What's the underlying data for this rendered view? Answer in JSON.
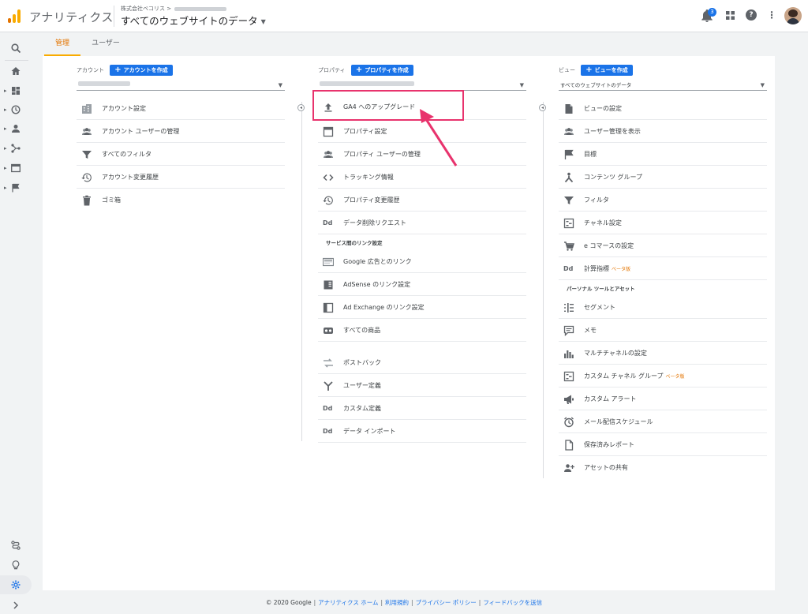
{
  "header": {
    "app_title": "アナリティクス",
    "breadcrumb": "株式会社ベコリス",
    "breadcrumb_sep": ">",
    "view_title": "すべてのウェブサイトのデータ",
    "notification_count": "3",
    "help_label": "?",
    "more_label": "⋮"
  },
  "tabs": [
    {
      "label": "管理"
    },
    {
      "label": "ユーザー"
    }
  ],
  "columns": {
    "account": {
      "label": "アカウント",
      "create_button": "アカウントを作成",
      "items": [
        {
          "label": "アカウント設定",
          "icon": "building-icon"
        },
        {
          "label": "アカウント ユーザーの管理",
          "icon": "people-icon"
        },
        {
          "label": "すべてのフィルタ",
          "icon": "filter-icon"
        },
        {
          "label": "アカウント変更履歴",
          "icon": "history-icon"
        },
        {
          "label": "ゴミ箱",
          "icon": "trash-icon"
        }
      ]
    },
    "property": {
      "label": "プロパティ",
      "create_button": "プロパティを作成",
      "items": [
        {
          "label": "GA4 へのアップグレード",
          "icon": "upload-icon"
        },
        {
          "label": "プロパティ設定",
          "icon": "window-icon"
        },
        {
          "label": "プロパティ ユーザーの管理",
          "icon": "people-icon"
        },
        {
          "label": "トラッキング情報",
          "icon": "code-icon"
        },
        {
          "label": "プロパティ変更履歴",
          "icon": "history-icon"
        },
        {
          "label": "データ削除リクエスト",
          "icon": "dd-icon"
        }
      ],
      "section_label": "サービス間のリンク設定",
      "link_items": [
        {
          "label": "Google 広告とのリンク",
          "icon": "ads-icon"
        },
        {
          "label": "AdSense のリンク設定",
          "icon": "adsense-icon"
        },
        {
          "label": "Ad Exchange のリンク設定",
          "icon": "adexchange-icon"
        },
        {
          "label": "すべての商品",
          "icon": "products-icon"
        }
      ],
      "more_items": [
        {
          "label": "ポストバック",
          "icon": "postback-icon"
        },
        {
          "label": "ユーザー定義",
          "icon": "user-defined-icon"
        },
        {
          "label": "カスタム定義",
          "icon": "dd-icon"
        },
        {
          "label": "データ インポート",
          "icon": "dd-icon"
        }
      ]
    },
    "view": {
      "label": "ビュー",
      "create_button": "ビューを作成",
      "selected_view": "すべてのウェブサイトのデータ",
      "items": [
        {
          "label": "ビューの設定",
          "icon": "document-icon"
        },
        {
          "label": "ユーザー管理を表示",
          "icon": "people-icon"
        },
        {
          "label": "目標",
          "icon": "flag-icon"
        },
        {
          "label": "コンテンツ グループ",
          "icon": "content-group-icon"
        },
        {
          "label": "フィルタ",
          "icon": "filter-icon"
        },
        {
          "label": "チャネル設定",
          "icon": "channel-icon"
        },
        {
          "label": "e コマースの設定",
          "icon": "cart-icon"
        },
        {
          "label": "計算指標",
          "icon": "dd-icon",
          "beta": "ベータ版"
        }
      ],
      "section_label": "パーソナル ツールとアセット",
      "tool_items": [
        {
          "label": "セグメント",
          "icon": "segment-icon"
        },
        {
          "label": "メモ",
          "icon": "memo-icon"
        },
        {
          "label": "マルチチャネルの設定",
          "icon": "bar-chart-icon"
        },
        {
          "label": "カスタム チャネル グループ",
          "icon": "channel-icon",
          "beta": "ベータ版"
        },
        {
          "label": "カスタム アラート",
          "icon": "megaphone-icon"
        },
        {
          "label": "メール配信スケジュール",
          "icon": "clock-icon"
        },
        {
          "label": "保存済みレポート",
          "icon": "report-icon"
        },
        {
          "label": "アセットの共有",
          "icon": "person-add-icon"
        }
      ]
    }
  },
  "dd_text": "Dd",
  "footer": {
    "copyright": "© 2020 Google",
    "links": [
      "アナリティクス ホーム",
      "利用規約",
      "プライバシー ポリシー",
      "フィードバックを送信"
    ]
  },
  "colors": {
    "accent": "#f9ab00",
    "primary": "#1a73e8",
    "highlight": "#e8336d"
  }
}
